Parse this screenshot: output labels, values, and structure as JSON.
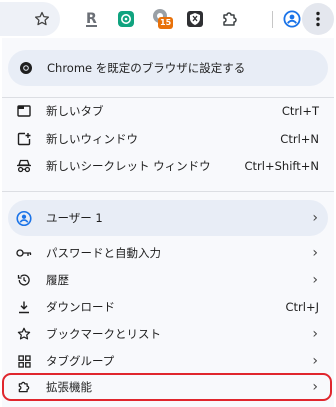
{
  "toolbar": {
    "icons": [
      "star-icon",
      "r-extension-icon",
      "chatgpt-extension-icon",
      "extension-badge-icon",
      "shield-extension-icon",
      "puzzle-icon",
      "profile-icon",
      "kebab-menu-icon"
    ],
    "badge_count": "15",
    "colors": {
      "badge": "#e8710a",
      "accent": "#1a73e8",
      "green": "#10a37f"
    }
  },
  "menu": {
    "default_browser": "Chrome を既定のブラウザに設定する",
    "new_tab": {
      "label": "新しいタブ",
      "shortcut": "Ctrl+T"
    },
    "new_window": {
      "label": "新しいウィンドウ",
      "shortcut": "Ctrl+N"
    },
    "incognito": {
      "label": "新しいシークレット ウィンドウ",
      "shortcut": "Ctrl+Shift+N"
    },
    "profile": {
      "label": "ユーザー 1"
    },
    "passwords": {
      "label": "パスワードと自動入力"
    },
    "history": {
      "label": "履歴"
    },
    "downloads": {
      "label": "ダウンロード",
      "shortcut": "Ctrl+J"
    },
    "bookmarks": {
      "label": "ブックマークとリスト"
    },
    "tab_groups": {
      "label": "タブグループ"
    },
    "extensions": {
      "label": "拡張機能"
    },
    "arrow": "›"
  },
  "highlight_color": "#e0262d"
}
